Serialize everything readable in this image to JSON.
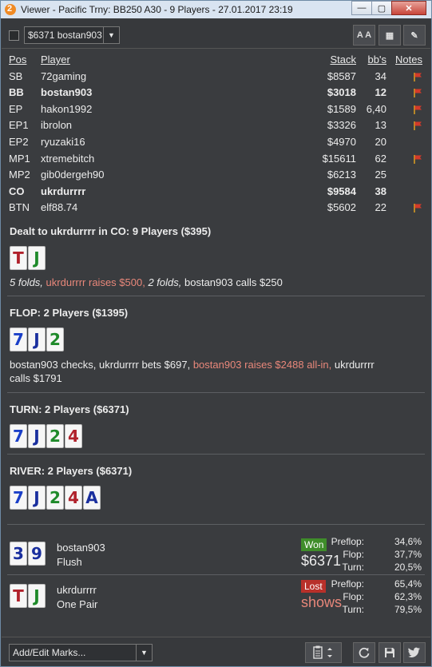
{
  "window": {
    "title": "Viewer - Pacific Trny: BB250 A30 - 9 Players - 27.01.2017 23:19",
    "minimize": "—",
    "maximize": "▢",
    "close": "✕"
  },
  "toolbar": {
    "hand_select": "$6371 bostan903",
    "font_size_icon": "A A",
    "grid_icon": "▦",
    "edit_icon": "✎"
  },
  "players": {
    "headers": {
      "pos": "Pos",
      "player": "Player",
      "stack": "Stack",
      "bbs": "bb's",
      "notes": "Notes"
    },
    "rows": [
      {
        "pos": "SB",
        "name": "72gaming",
        "stack": "$8587",
        "bbs": "34",
        "flag": true,
        "bold": false
      },
      {
        "pos": "BB",
        "name": "bostan903",
        "stack": "$3018",
        "bbs": "12",
        "flag": true,
        "bold": true
      },
      {
        "pos": "EP",
        "name": "hakon1992",
        "stack": "$1589",
        "bbs": "6,40",
        "flag": true,
        "bold": false
      },
      {
        "pos": "EP1",
        "name": "ibrolon",
        "stack": "$3326",
        "bbs": "13",
        "flag": true,
        "bold": false
      },
      {
        "pos": "EP2",
        "name": "ryuzaki16",
        "stack": "$4970",
        "bbs": "20",
        "flag": false,
        "bold": false
      },
      {
        "pos": "MP1",
        "name": "xtremebitch",
        "stack": "$15611",
        "bbs": "62",
        "flag": true,
        "bold": false
      },
      {
        "pos": "MP2",
        "name": "gib0dergeh90",
        "stack": "$6213",
        "bbs": "25",
        "flag": false,
        "bold": false
      },
      {
        "pos": "CO",
        "name": "ukrdurrrr",
        "stack": "$9584",
        "bbs": "38",
        "flag": false,
        "bold": true
      },
      {
        "pos": "BTN",
        "name": "elf88.74",
        "stack": "$5602",
        "bbs": "22",
        "flag": true,
        "bold": false
      }
    ]
  },
  "preflop": {
    "title": "Dealt to ukrdurrrr in CO: 9 Players ($395)",
    "cards": [
      {
        "rank": "T",
        "suit": "h"
      },
      {
        "rank": "J",
        "suit": "c"
      }
    ],
    "a1": "5 folds,",
    "a2": "ukrdurrrr raises $500,",
    "a3": "2 folds,",
    "a4": "bostan903 calls $250"
  },
  "flop": {
    "title": "FLOP: 2 Players ($1395)",
    "cards": [
      {
        "rank": "7",
        "suit": "d"
      },
      {
        "rank": "J",
        "suit": "s"
      },
      {
        "rank": "2",
        "suit": "c"
      }
    ],
    "a1": "bostan903 checks, ukrdurrrr bets $697,",
    "a2": "bostan903 raises $2488 all-in,",
    "a3": "ukrdurrrr",
    "a4": "calls $1791"
  },
  "turn": {
    "title": "TURN: 2 Players ($6371)",
    "cards": [
      {
        "rank": "7",
        "suit": "d"
      },
      {
        "rank": "J",
        "suit": "s"
      },
      {
        "rank": "2",
        "suit": "c"
      },
      {
        "rank": "4",
        "suit": "h"
      }
    ]
  },
  "river": {
    "title": "RIVER: 2 Players ($6371)",
    "cards": [
      {
        "rank": "7",
        "suit": "d"
      },
      {
        "rank": "J",
        "suit": "s"
      },
      {
        "rank": "2",
        "suit": "c"
      },
      {
        "rank": "4",
        "suit": "h"
      },
      {
        "rank": "A",
        "suit": "s"
      }
    ]
  },
  "results": [
    {
      "cards": [
        {
          "rank": "3",
          "suit": "s"
        },
        {
          "rank": "9",
          "suit": "s"
        }
      ],
      "name": "bostan903",
      "hand": "Flush",
      "badge": "Won",
      "amount": "$6371",
      "preflop_label": "Preflop:",
      "preflop": "34,6%",
      "flop_label": "Flop:",
      "flop": "37,7%",
      "turn_label": "Turn:",
      "turn": "20,5%"
    },
    {
      "cards": [
        {
          "rank": "T",
          "suit": "h"
        },
        {
          "rank": "J",
          "suit": "c"
        }
      ],
      "name": "ukrdurrrr",
      "hand": "One Pair",
      "badge": "Lost",
      "amount": "shows",
      "preflop_label": "Preflop:",
      "preflop": "65,4%",
      "flop_label": "Flop:",
      "flop": "62,3%",
      "turn_label": "Turn:",
      "turn": "79,5%"
    }
  ],
  "bottombar": {
    "marks_select": "Add/Edit Marks...",
    "clipboard_icon": "clipboard-icon",
    "reload_icon": "reload-icon",
    "save_icon": "save-icon",
    "twitter_icon": "twitter-icon"
  },
  "colors": {
    "background": "#3a3c3f",
    "raise_text": "#e8877a",
    "won_badge": "#3f8d2a",
    "lost_badge": "#b8302a",
    "flag": "#d23a2a"
  }
}
